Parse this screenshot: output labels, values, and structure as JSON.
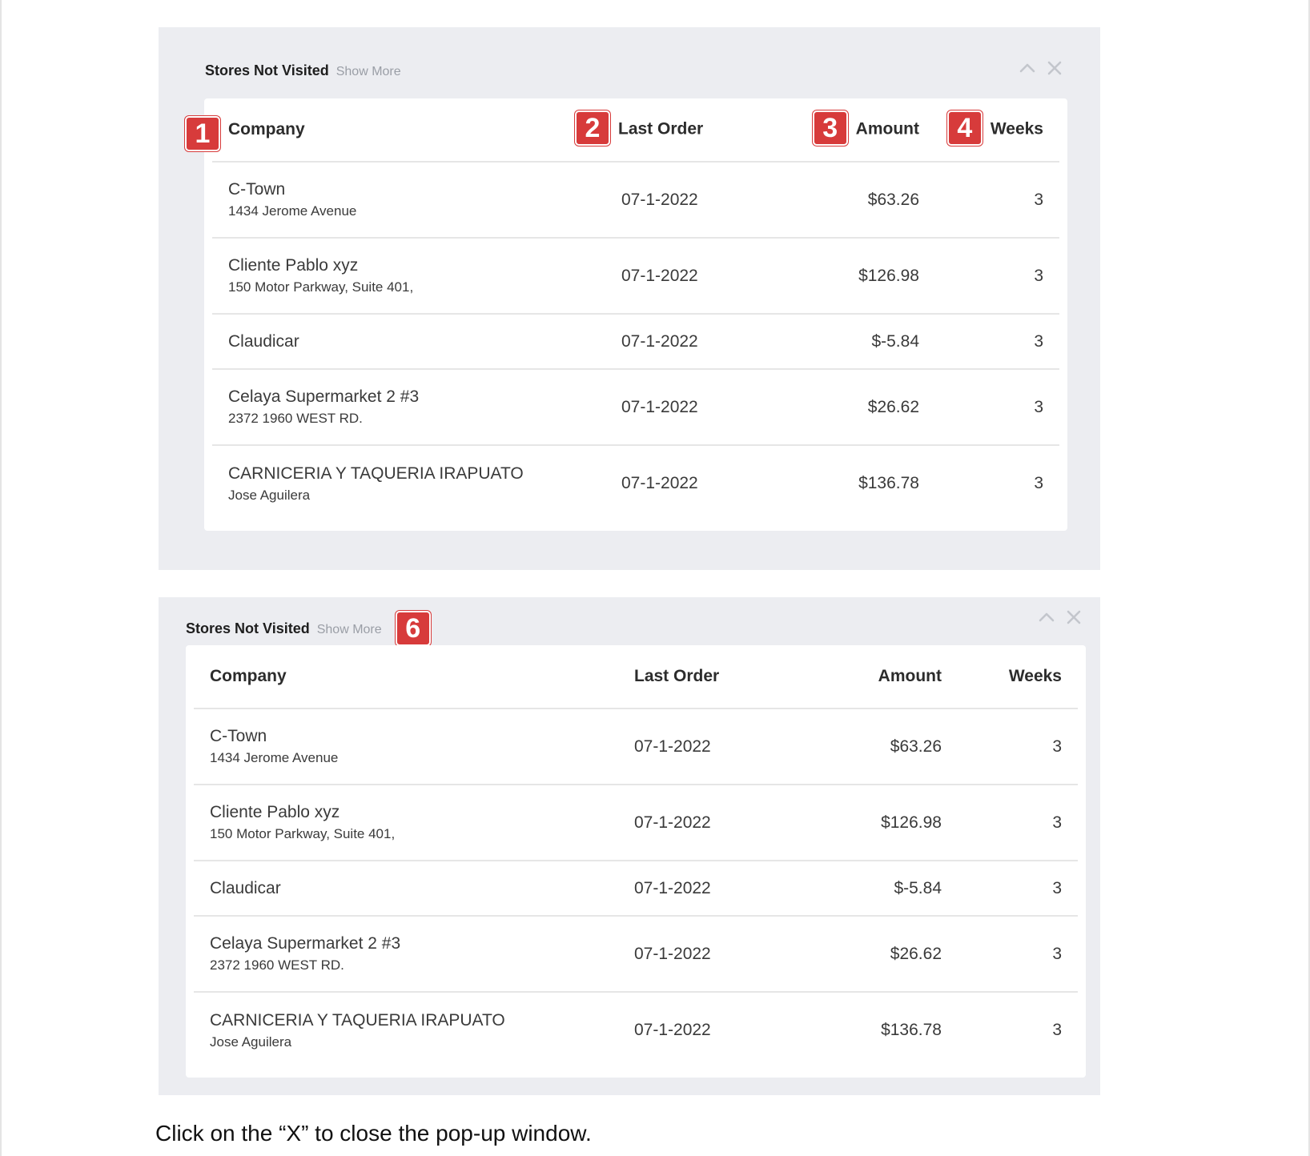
{
  "widget_a": {
    "title": "Stores Not Visited",
    "show_more": "Show More",
    "badges": [
      "1",
      "2",
      "3",
      "4"
    ],
    "columns": {
      "company": "Company",
      "last_order": "Last Order",
      "amount": "Amount",
      "weeks": "Weeks"
    },
    "rows": [
      {
        "company": "C-Town",
        "address": "1434 Jerome Avenue",
        "last_order": "07-1-2022",
        "amount": "$63.26",
        "weeks": "3"
      },
      {
        "company": "Cliente Pablo xyz",
        "address": "150 Motor Parkway, Suite 401,",
        "last_order": "07-1-2022",
        "amount": "$126.98",
        "weeks": "3"
      },
      {
        "company": "Claudicar",
        "address": "",
        "last_order": "07-1-2022",
        "amount": "$-5.84",
        "weeks": "3"
      },
      {
        "company": "Celaya Supermarket 2 #3",
        "address": "2372 1960 WEST RD.",
        "last_order": "07-1-2022",
        "amount": "$26.62",
        "weeks": "3"
      },
      {
        "company": "CARNICERIA Y TAQUERIA IRAPUATO",
        "address": "Jose Aguilera",
        "last_order": "07-1-2022",
        "amount": "$136.78",
        "weeks": "3"
      }
    ],
    "icons": {
      "collapse": "chevron-up-icon",
      "close": "close-icon"
    }
  },
  "widget_b": {
    "title": "Stores Not Visited",
    "show_more": "Show More",
    "badge": "6",
    "columns": {
      "company": "Company",
      "last_order": "Last Order",
      "amount": "Amount",
      "weeks": "Weeks"
    },
    "rows": [
      {
        "company": "C-Town",
        "address": "1434 Jerome Avenue",
        "last_order": "07-1-2022",
        "amount": "$63.26",
        "weeks": "3"
      },
      {
        "company": "Cliente Pablo xyz",
        "address": "150 Motor Parkway, Suite 401,",
        "last_order": "07-1-2022",
        "amount": "$126.98",
        "weeks": "3"
      },
      {
        "company": "Claudicar",
        "address": "",
        "last_order": "07-1-2022",
        "amount": "$-5.84",
        "weeks": "3"
      },
      {
        "company": "Celaya Supermarket 2 #3",
        "address": "2372 1960 WEST RD.",
        "last_order": "07-1-2022",
        "amount": "$26.62",
        "weeks": "3"
      },
      {
        "company": "CARNICERIA Y TAQUERIA IRAPUATO",
        "address": "Jose Aguilera",
        "last_order": "07-1-2022",
        "amount": "$136.78",
        "weeks": "3"
      }
    ],
    "icons": {
      "collapse": "chevron-up-icon",
      "close": "close-icon"
    }
  },
  "caption": "Click on the “X” to close the pop-up window.",
  "colors": {
    "badge": "#d73b3b",
    "panel_bg": "#ecedf1",
    "card_bg": "#ffffff",
    "muted": "#9a9ea6"
  }
}
